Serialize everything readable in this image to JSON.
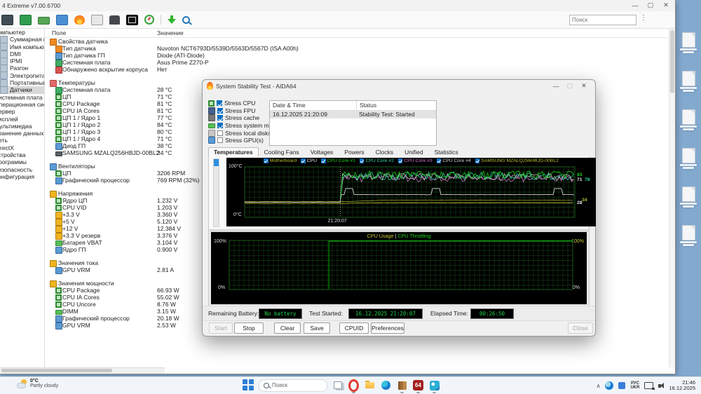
{
  "colors": {
    "accent": "#0b6fc2",
    "lcd_green": "#1ed24a",
    "desktop_blue": "#83a9cf",
    "graph_bg": "#000000",
    "grid_green": "#123a12"
  },
  "app": {
    "title": "4 Extreme v7.00.6700",
    "window_controls": [
      "minimize",
      "maximize",
      "close"
    ],
    "toolbar_icons": [
      "chip",
      "board",
      "memory",
      "display",
      "flame",
      "share",
      "user",
      "osd",
      "gauge",
      "sep",
      "download",
      "searchm"
    ],
    "search": {
      "placeholder": "Поиск",
      "menu_glyph": "⋮"
    },
    "columns": {
      "field": "Поле",
      "value": "Значение"
    },
    "sidebar": {
      "items": [
        {
          "label": "Компьютер",
          "level": 0
        },
        {
          "label": "Суммарная информация",
          "level": 1
        },
        {
          "label": "Имя компьютера",
          "level": 1
        },
        {
          "label": "DMI",
          "level": 1
        },
        {
          "label": "IPMI",
          "level": 1
        },
        {
          "label": "Разгон",
          "level": 1
        },
        {
          "label": "Электропитание",
          "level": 1
        },
        {
          "label": "Портативный ПК",
          "level": 1
        },
        {
          "label": "Датчики",
          "level": 1,
          "selected": true
        },
        {
          "label": "Системная плата",
          "level": 0
        },
        {
          "label": "Операционная система",
          "level": 0
        },
        {
          "label": "Сервер",
          "level": 0
        },
        {
          "label": "Дисплей",
          "level": 0
        },
        {
          "label": "Мультимедиа",
          "level": 0
        },
        {
          "label": "Хранение данных",
          "level": 0
        },
        {
          "label": "Сеть",
          "level": 0
        },
        {
          "label": "DirectX",
          "level": 0
        },
        {
          "label": "Устройства",
          "level": 0
        },
        {
          "label": "Программы",
          "level": 0
        },
        {
          "label": "Безопасность",
          "level": 0
        },
        {
          "label": "Конфигурация",
          "level": 0
        }
      ]
    },
    "sensor_groups": [
      {
        "section": "Свойства датчика",
        "icon": "sensor",
        "rows": [
          {
            "icon": "sensor",
            "label": "Тип датчика",
            "value": "Nuvoton NCT6793D/5539D/5563D/5567D  (ISA A00h)"
          },
          {
            "icon": "gpu",
            "label": "Тип датчика ГП",
            "value": "Diode  (ATI-Diode)"
          },
          {
            "icon": "board",
            "label": "Системная плата",
            "value": "Asus Prime Z270-P"
          },
          {
            "icon": "shield",
            "label": "Обнаружено вскрытие корпуса",
            "value": "Нет"
          }
        ]
      },
      {
        "section": "Температуры",
        "icon": "temp",
        "rows": [
          {
            "icon": "board",
            "label": "Системная плата",
            "value": "28 °C"
          },
          {
            "icon": "cpu",
            "label": "ЦП",
            "value": "71 °C"
          },
          {
            "icon": "cpu",
            "label": "CPU Package",
            "value": "81 °C"
          },
          {
            "icon": "cpu",
            "label": "CPU IA Cores",
            "value": "81 °C"
          },
          {
            "icon": "cpu",
            "label": "ЦП 1 / Ядро 1",
            "value": "77 °C"
          },
          {
            "icon": "cpu",
            "label": "ЦП 1 / Ядро 2",
            "value": "84 °C"
          },
          {
            "icon": "cpu",
            "label": "ЦП 1 / Ядро 3",
            "value": "80 °C"
          },
          {
            "icon": "cpu",
            "label": "ЦП 1 / Ядро 4",
            "value": "71 °C"
          },
          {
            "icon": "gpu",
            "label": "Диод ГП",
            "value": "38 °C"
          },
          {
            "icon": "ssd",
            "label": "SAMSUNG MZALQ256HBJD-00BL2",
            "value": "34 °C"
          }
        ]
      },
      {
        "section": "Вентиляторы",
        "icon": "fan",
        "rows": [
          {
            "icon": "cpu",
            "label": "ЦП",
            "value": "3206 RPM"
          },
          {
            "icon": "gpu",
            "label": "Графический процессор",
            "value": "769 RPM  (32%)"
          }
        ]
      },
      {
        "section": "Напряжения",
        "icon": "volt",
        "rows": [
          {
            "icon": "cpu",
            "label": "Ядро ЦП",
            "value": "1.232 V"
          },
          {
            "icon": "cpu",
            "label": "CPU VID",
            "value": "1.203 V"
          },
          {
            "icon": "volt",
            "label": "+3.3 V",
            "value": "3.360 V"
          },
          {
            "icon": "volt",
            "label": "+5 V",
            "value": "5.120 V"
          },
          {
            "icon": "volt",
            "label": "+12 V",
            "value": "12.384 V"
          },
          {
            "icon": "volt",
            "label": "+3.3 V резерв",
            "value": "3.376 V"
          },
          {
            "icon": "battery",
            "label": "Батарея VBAT",
            "value": "3.104 V"
          },
          {
            "icon": "gpu",
            "label": "Ядро ГП",
            "value": "0.900 V"
          }
        ]
      },
      {
        "section": "Значения тока",
        "icon": "volt",
        "rows": [
          {
            "icon": "gpu",
            "label": "GPU VRM",
            "value": "2.81 A"
          }
        ]
      },
      {
        "section": "Значения мощности",
        "icon": "volt",
        "rows": [
          {
            "icon": "cpu",
            "label": "CPU Package",
            "value": "66.93 W"
          },
          {
            "icon": "cpu",
            "label": "CPU IA Cores",
            "value": "55.02 W"
          },
          {
            "icon": "cpu",
            "label": "CPU Uncore",
            "value": "8.76 W"
          },
          {
            "icon": "ram",
            "label": "DIMM",
            "value": "3.15 W"
          },
          {
            "icon": "gpu",
            "label": "Графический процессор",
            "value": "20.18 W"
          },
          {
            "icon": "gpu",
            "label": "GPU VRM",
            "value": "2.53 W"
          }
        ]
      }
    ]
  },
  "dialog": {
    "title": "System Stability Test - AIDA64",
    "stress_options": [
      {
        "label": "Stress CPU",
        "checked": true,
        "icon": "cpu"
      },
      {
        "label": "Stress FPU",
        "checked": true,
        "icon": "fpu"
      },
      {
        "label": "Stress cache",
        "checked": true,
        "icon": "cache"
      },
      {
        "label": "Stress system memory",
        "checked": true,
        "icon": "ram"
      },
      {
        "label": "Stress local disks",
        "checked": false,
        "icon": "disk"
      },
      {
        "label": "Stress GPU(s)",
        "checked": false,
        "icon": "gpu"
      }
    ],
    "log": {
      "headers": [
        "Date & Time",
        "Status"
      ],
      "rows": [
        {
          "time": "16.12.2025 21:20:09",
          "status": "Stability Test: Started",
          "selected": true
        }
      ]
    },
    "tabs": [
      {
        "label": "Temperatures",
        "active": true
      },
      {
        "label": "Cooling Fans"
      },
      {
        "label": "Voltages"
      },
      {
        "label": "Powers"
      },
      {
        "label": "Clocks"
      },
      {
        "label": "Unified"
      },
      {
        "label": "Statistics"
      }
    ],
    "temp_graph": {
      "y_max_label": "100°C",
      "y_min_label": "0°C",
      "time_label": "21:20:07",
      "y_range": [
        0,
        100
      ],
      "marker_frac": 0.29,
      "legend": [
        {
          "label": "Motherboard",
          "color": "#b9b931"
        },
        {
          "label": "CPU",
          "color": "#e6e6e6"
        },
        {
          "label": "CPU Core #1",
          "color": "#17d517"
        },
        {
          "label": "CPU Core #2",
          "color": "#2fd5a0"
        },
        {
          "label": "CPU Core #3",
          "color": "#c974c9"
        },
        {
          "label": "CPU Core #4",
          "color": "#cfcfcf"
        },
        {
          "label": "SAMSUNG MZALQ256HBJD-00BL2",
          "color": "#b9b931"
        }
      ],
      "series": [
        {
          "name": "Motherboard",
          "color": "#b9b931",
          "mode": "flat",
          "base": 27.5,
          "post_delta": 1
        },
        {
          "name": "SAMSUNG MZALQ256HBJD-00BL2",
          "color": "#9b9b2a",
          "mode": "flat",
          "base": 31,
          "post_delta": 3
        },
        {
          "name": "CPU",
          "color": "#e6e6e6",
          "mode": "pulse",
          "pre_base": 30,
          "base": 45,
          "high": 57,
          "pulses": [
            0.315,
            0.58,
            0.95
          ]
        },
        {
          "name": "CPU Core #4",
          "color": "#cfcfcf",
          "mode": "noise",
          "base": 80,
          "amp": 7
        },
        {
          "name": "CPU Core #3",
          "color": "#c974c9",
          "mode": "noise",
          "base": 77,
          "amp": 7
        },
        {
          "name": "CPU Core #2",
          "color": "#2fd5a0",
          "mode": "noise",
          "base": 82,
          "amp": 8
        },
        {
          "name": "CPU Core #1",
          "color": "#17d517",
          "mode": "noise",
          "base": 84,
          "amp": 8
        }
      ],
      "right_values": [
        {
          "value": 83,
          "color": "#17d517",
          "dx": 0
        },
        {
          "value": 74,
          "text": "71",
          "color": "#e6e6e6",
          "dx": 0
        },
        {
          "value": 74,
          "text": "78",
          "color": "#2fd5a0",
          "dx": 11
        },
        {
          "value": 34,
          "color": "#b9b931",
          "dx": 7
        },
        {
          "value": 28,
          "color": "#e6e6e6",
          "dx": 0
        }
      ]
    },
    "usage_graph": {
      "title_left": "CPU Usage",
      "title_sep": "  |  ",
      "title_right": "CPU Throttling",
      "title_left_color": "#c8c832",
      "title_right_color": "#17d517",
      "y_max_left": "100%",
      "y_max_right": "100%",
      "y_min_left": "0%",
      "y_min_right": "0%",
      "usage_value": 100
    },
    "status": {
      "battery_label": "Remaining Battery:",
      "battery_value": "No battery",
      "started_label": "Test Started:",
      "started_value": "16.12.2025 21:20:07",
      "elapsed_label": "Elapsed Time:",
      "elapsed_value": "00:26:50"
    },
    "buttons": [
      {
        "label": "Start",
        "disabled": true
      },
      {
        "label": "Stop"
      },
      {
        "label": "Clear"
      },
      {
        "label": "Save"
      },
      {
        "label": "CPUID"
      },
      {
        "label": "Preferences"
      }
    ],
    "close_button": {
      "label": "Close",
      "disabled": true
    }
  },
  "desktop": {
    "icon_count": 6
  },
  "taskbar": {
    "search_placeholder": "Поиск",
    "aida_label": "64",
    "icons": [
      {
        "name": "task-view",
        "running": false
      },
      {
        "name": "opera",
        "running": true
      },
      {
        "name": "explorer",
        "running": false
      },
      {
        "name": "edge",
        "running": false
      },
      {
        "name": "library",
        "running": true
      },
      {
        "name": "aida64",
        "running": true
      },
      {
        "name": "paint",
        "running": true
      }
    ],
    "tray": {
      "lang_top": "РУС",
      "lang_bottom": "UKR",
      "time": "21:46",
      "date": "16.12.2025"
    }
  },
  "weather": {
    "temp": "0°C",
    "desc": "Partly cloudy"
  }
}
